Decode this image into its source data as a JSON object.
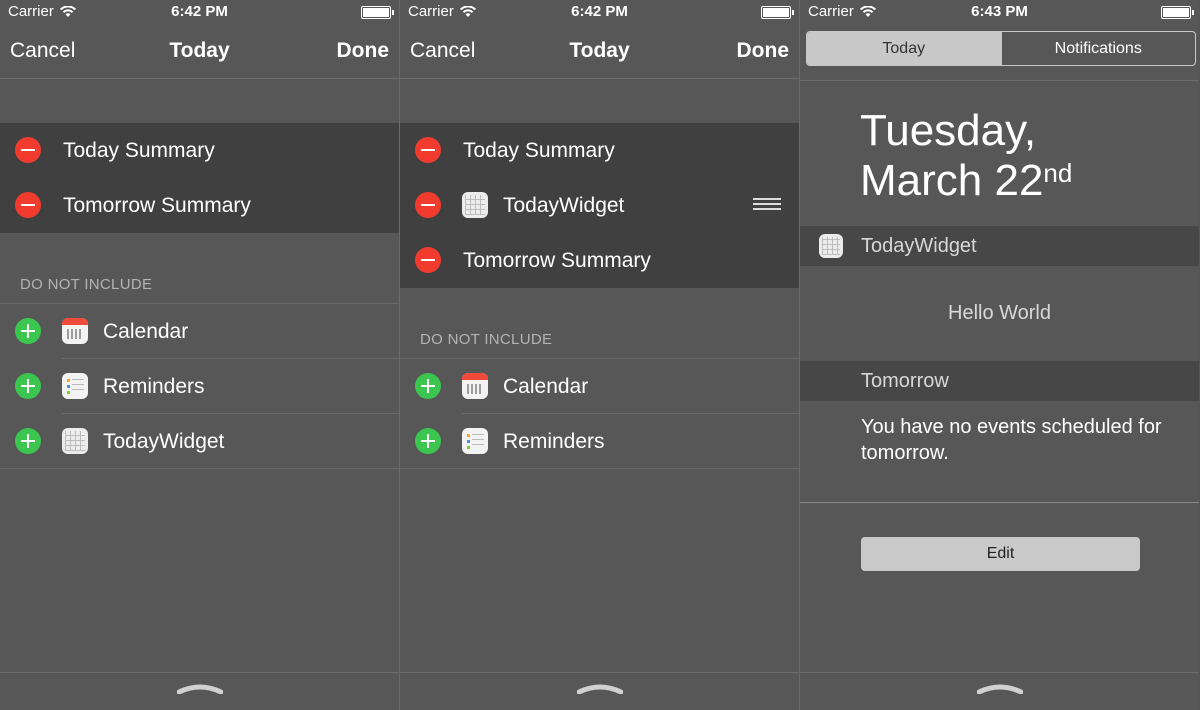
{
  "status": {
    "carrier": "Carrier",
    "time1": "6:42 PM",
    "time2": "6:42 PM",
    "time3": "6:43 PM"
  },
  "nav": {
    "cancel": "Cancel",
    "title": "Today",
    "done": "Done"
  },
  "screen1": {
    "included": [
      "Today Summary",
      "Tomorrow Summary"
    ],
    "section_header": "DO NOT INCLUDE",
    "excluded": [
      "Calendar",
      "Reminders",
      "TodayWidget"
    ]
  },
  "screen2": {
    "included": [
      "Today Summary",
      "TodayWidget",
      "Tomorrow Summary"
    ],
    "section_header": "DO NOT INCLUDE",
    "excluded": [
      "Calendar",
      "Reminders"
    ]
  },
  "screen3": {
    "tabs": [
      "Today",
      "Notifications"
    ],
    "date_line1": "Tuesday,",
    "date_line2": "March 22",
    "date_suffix": "nd",
    "widget_title": "TodayWidget",
    "widget_body": "Hello World",
    "tomorrow_title": "Tomorrow",
    "tomorrow_body": "You have no events scheduled for tomorrow.",
    "edit_label": "Edit"
  },
  "icons": {
    "add": "plus-circle-icon",
    "remove": "minus-circle-icon",
    "calendar": "calendar-app-icon",
    "reminders": "reminders-app-icon",
    "widget": "todaywidget-app-icon",
    "reorder": "reorder-handle-icon",
    "grabber": "pull-up-grabber-icon"
  },
  "colors": {
    "remove_red": "#f23b2f",
    "add_green": "#3cc54f",
    "background": "#575757",
    "group_dark": "#404040"
  }
}
